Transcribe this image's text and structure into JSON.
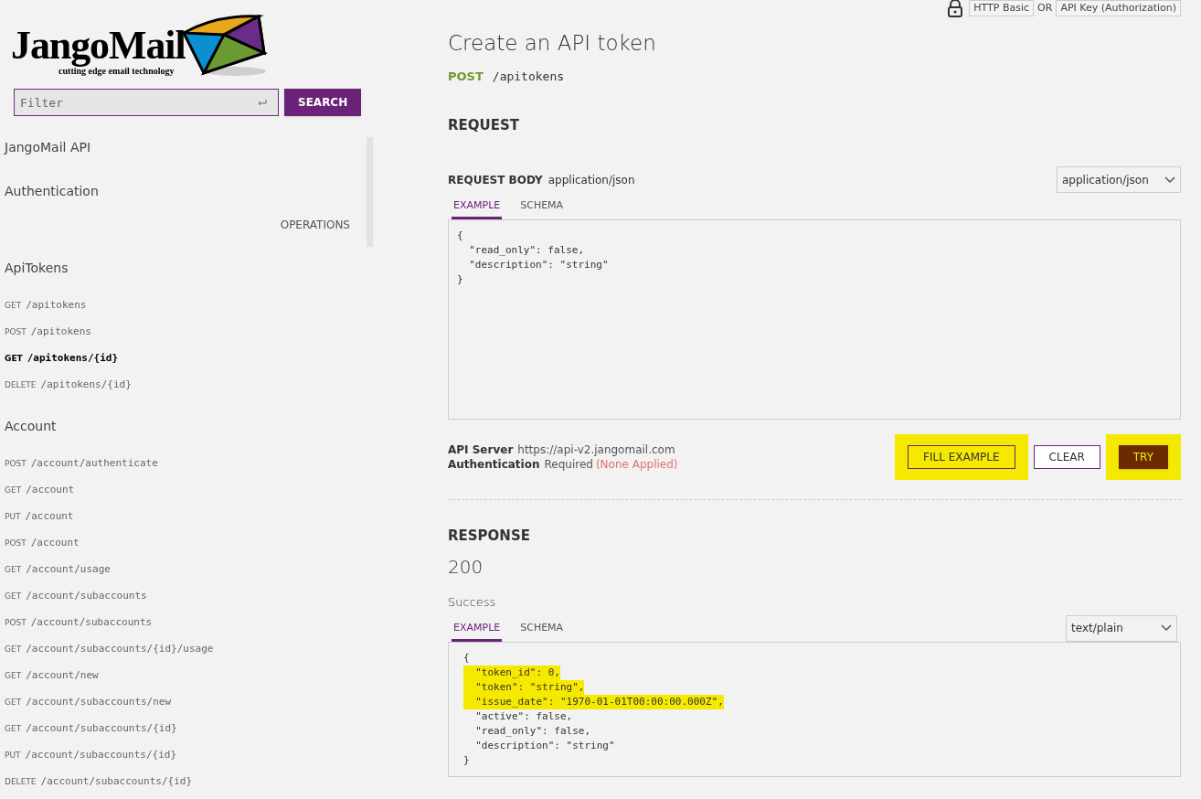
{
  "logo": {
    "name": "JangoMail",
    "tagline": "cutting edge email technology"
  },
  "search": {
    "placeholder": "Filter",
    "button": "SEARCH"
  },
  "sidebar": {
    "sections": [
      {
        "title": "JangoMail API"
      },
      {
        "title": "Authentication",
        "link": "OPERATIONS"
      },
      {
        "title": "ApiTokens",
        "items": [
          {
            "method": "GET",
            "path": "/apitokens",
            "selected": false
          },
          {
            "method": "POST",
            "path": "/apitokens",
            "selected": false
          },
          {
            "method": "GET",
            "path": "/apitokens/{id}",
            "selected": true
          },
          {
            "method": "DELETE",
            "path": "/apitokens/{id}",
            "selected": false
          }
        ]
      },
      {
        "title": "Account",
        "items": [
          {
            "method": "POST",
            "path": "/account/authenticate",
            "selected": false
          },
          {
            "method": "GET",
            "path": "/account",
            "selected": false
          },
          {
            "method": "PUT",
            "path": "/account",
            "selected": false
          },
          {
            "method": "POST",
            "path": "/account",
            "selected": false
          },
          {
            "method": "GET",
            "path": "/account/usage",
            "selected": false
          },
          {
            "method": "GET",
            "path": "/account/subaccounts",
            "selected": false
          },
          {
            "method": "POST",
            "path": "/account/subaccounts",
            "selected": false
          },
          {
            "method": "GET",
            "path": "/account/subaccounts/{id}/usage",
            "selected": false
          },
          {
            "method": "GET",
            "path": "/account/new",
            "selected": false
          },
          {
            "method": "GET",
            "path": "/account/subaccounts/new",
            "selected": false
          },
          {
            "method": "GET",
            "path": "/account/subaccounts/{id}",
            "selected": false
          },
          {
            "method": "PUT",
            "path": "/account/subaccounts/{id}",
            "selected": false
          },
          {
            "method": "DELETE",
            "path": "/account/subaccounts/{id}",
            "selected": false
          }
        ]
      }
    ]
  },
  "auth_bar": {
    "options": [
      "HTTP Basic",
      "API Key (Authorization)"
    ],
    "separator": "OR"
  },
  "operation": {
    "title": "Create an API token",
    "method": "POST",
    "path": "/apitokens"
  },
  "request": {
    "heading": "REQUEST",
    "body_label": "REQUEST BODY",
    "body_type": "application/json",
    "content_type": "application/json",
    "tabs": [
      {
        "label": "EXAMPLE",
        "selected": true
      },
      {
        "label": "SCHEMA",
        "selected": false
      }
    ],
    "lines": [
      "{",
      "  \"read_only\": false,",
      "  \"description\": \"string\"",
      "}"
    ],
    "server_label": "API Server",
    "server": "https://api-v2.jangomail.com",
    "auth_label": "Authentication",
    "auth_value": "Required",
    "auth_note": "(None Applied)",
    "buttons": [
      {
        "label": "FILL EXAMPLE",
        "kind": "outline",
        "highlighted": true
      },
      {
        "label": "CLEAR",
        "kind": "outline",
        "highlighted": false
      },
      {
        "label": "TRY",
        "kind": "primary",
        "highlighted": true
      }
    ]
  },
  "response": {
    "heading": "RESPONSE",
    "code": "200",
    "description": "Success",
    "content_type": "text/plain",
    "tabs": [
      {
        "label": "EXAMPLE",
        "selected": true
      },
      {
        "label": "SCHEMA",
        "selected": false
      }
    ],
    "lines": [
      {
        "text": "{",
        "highlighted": false
      },
      {
        "text": "  \"token_id\": 0,",
        "highlighted": true
      },
      {
        "text": "  \"token\": \"string\",",
        "highlighted": true
      },
      {
        "text": "  \"issue_date\": \"1970-01-01T00:00:00.000Z\",",
        "highlighted": true
      },
      {
        "text": "  \"active\": false,",
        "highlighted": false
      },
      {
        "text": "  \"read_only\": false,",
        "highlighted": false
      },
      {
        "text": "  \"description\": \"string\"",
        "highlighted": false
      },
      {
        "text": "}",
        "highlighted": false
      }
    ]
  }
}
